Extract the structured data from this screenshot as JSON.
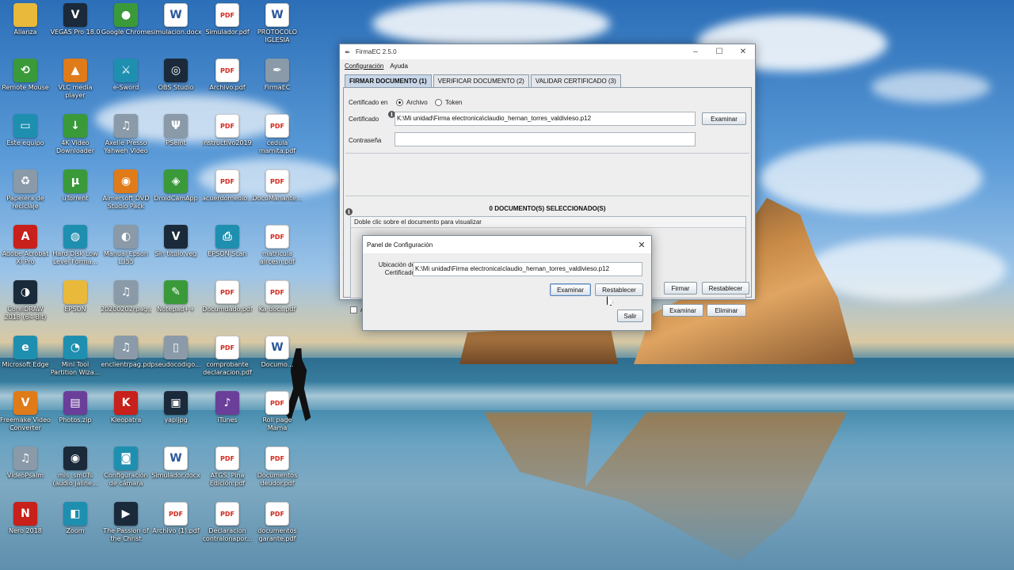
{
  "desktop": {
    "icons": [
      {
        "label": "Alianza",
        "icon": "folder-icon"
      },
      {
        "label": "VEGAS Pro 18.0",
        "icon": "vegas-icon"
      },
      {
        "label": "Google Chrome",
        "icon": "chrome-icon"
      },
      {
        "label": "simulacion.docx",
        "icon": "word-icon"
      },
      {
        "label": "Simulador.pdf",
        "icon": "pdf-icon"
      },
      {
        "label": "PROTOCOLO IGLESIA ALIAN...",
        "icon": "word-icon"
      },
      {
        "label": "Remote Mouse",
        "icon": "remote-mouse-icon"
      },
      {
        "label": "VLC media player",
        "icon": "vlc-icon"
      },
      {
        "label": "e-Sword",
        "icon": "esword-icon"
      },
      {
        "label": "OBS Studio",
        "icon": "obs-icon"
      },
      {
        "label": "Archivo.pdf",
        "icon": "pdf-icon"
      },
      {
        "label": "FirmaEC",
        "icon": "firmaec-icon"
      },
      {
        "label": "Este equipo",
        "icon": "computer-icon"
      },
      {
        "label": "4K Video Downloader",
        "icon": "downloader-icon"
      },
      {
        "label": "Axelle Presso Yahweh Video ...",
        "icon": "media-icon"
      },
      {
        "label": "PSeint",
        "icon": "pseint-icon"
      },
      {
        "label": "instructivo2019...",
        "icon": "pdf-icon"
      },
      {
        "label": "cedula mamita.pdf",
        "icon": "pdf-icon"
      },
      {
        "label": "Papelera de reciclaje",
        "icon": "recycle-bin-icon"
      },
      {
        "label": "uTorrent",
        "icon": "utorrent-icon"
      },
      {
        "label": "Aimersoft DVD Studio Pack",
        "icon": "dvd-icon"
      },
      {
        "label": "DroidCamApp",
        "icon": "droidcam-icon"
      },
      {
        "label": "acuerdomedio...",
        "icon": "pdf-icon"
      },
      {
        "label": "DocuManante...",
        "icon": "pdf-icon"
      },
      {
        "label": "Adobe Acrobat XI Pro",
        "icon": "acrobat-icon"
      },
      {
        "label": "Hard Disk Low Level Forma...",
        "icon": "disk-icon"
      },
      {
        "label": "Manual Epson L355",
        "icon": "manual-icon"
      },
      {
        "label": "Sin título.veg",
        "icon": "vegas-icon"
      },
      {
        "label": "EPSON Scan",
        "icon": "scanner-icon"
      },
      {
        "label": "matricula alrcesn.pdf",
        "icon": "pdf-icon"
      },
      {
        "label": "CorelDRAW 2018 (64-Bit)",
        "icon": "corel-icon"
      },
      {
        "label": "EPSON",
        "icon": "folder-icon"
      },
      {
        "label": "20200202rpag.pd",
        "icon": "media-icon"
      },
      {
        "label": "Notepad++",
        "icon": "notepad-icon"
      },
      {
        "label": "Documdado.pdf",
        "icon": "pdf-icon"
      },
      {
        "label": "Ka docs.pdf",
        "icon": "pdf-icon"
      },
      {
        "label": "Microsoft Edge",
        "icon": "edge-icon"
      },
      {
        "label": "Mini Tool Partition Wiza...",
        "icon": "partition-icon"
      },
      {
        "label": "enclientrpag.pd",
        "icon": "media-icon"
      },
      {
        "label": "pseudocodigo...",
        "icon": "file-icon"
      },
      {
        "label": "comprobante declaracion.pdf",
        "icon": "pdf-icon"
      },
      {
        "label": "Documo...",
        "icon": "word-icon"
      },
      {
        "label": "Freemake Video Converter",
        "icon": "freemake-icon"
      },
      {
        "label": "Photos.zip",
        "icon": "zip-icon"
      },
      {
        "label": "Kleopatra",
        "icon": "kleopatra-icon"
      },
      {
        "label": "yapijpg",
        "icon": "image-icon"
      },
      {
        "label": "iTunes",
        "icon": "itunes-icon"
      },
      {
        "label": "Roll page Mama Odd.oepdf",
        "icon": "pdf-icon"
      },
      {
        "label": "VideoPsalm",
        "icon": "media-icon"
      },
      {
        "label": "mis .sm0Ts (audio jaline...",
        "icon": "audio-icon"
      },
      {
        "label": "Configuración de cámara Logitech",
        "icon": "camera-icon"
      },
      {
        "label": "Simulador.docx",
        "icon": "word-icon"
      },
      {
        "label": "ATGS. Pina Edición.pdf",
        "icon": "pdf-icon"
      },
      {
        "label": "Documentos deudor.pdf",
        "icon": "pdf-icon"
      },
      {
        "label": "Nero 2018",
        "icon": "nero-icon"
      },
      {
        "label": "Zoom",
        "icon": "zoom-icon"
      },
      {
        "label": "The Passion of the Christ (200...",
        "icon": "video-icon"
      },
      {
        "label": "Archivo (1).pdf",
        "icon": "pdf-icon"
      },
      {
        "label": "Declaracion contralonapor...",
        "icon": "pdf-icon"
      },
      {
        "label": "documentos garante.pdf",
        "icon": "pdf-icon"
      }
    ]
  },
  "main_window": {
    "title": "FirmaEC 2.5.0",
    "menu": [
      "Configuración",
      "Ayuda"
    ],
    "tabs": [
      "FIRMAR DOCUMENTO (1)",
      "VERIFICAR DOCUMENTO (2)",
      "VALIDAR CERTIFICADO (3)"
    ],
    "cert_in_label": "Certificado en",
    "radio_archivo": "Archivo",
    "radio_token": "Token",
    "certificado_label": "Certificado",
    "certificado_value": "K:\\Mi unidad\\Firma electronica\\claudio_hernan_torres_valdivieso.p12",
    "examinar_label": "Examinar",
    "password_label": "Contraseña",
    "password_value": "",
    "docs_header": "0 DOCUMENTO(S) SELECCIONADO(S)",
    "docs_hint": "Doble clic sobre el documento para visualizar",
    "checkbox_label": "A",
    "docs_examinar": "Examinar",
    "eliminar": "Eliminar",
    "firmar": "Firmar",
    "restablecer": "Restablecer"
  },
  "config_dialog": {
    "title": "Panel de Configuración",
    "ubicacion_label_1": "Ubicación de",
    "ubicacion_label_2": "Certificado",
    "ubicacion_value": "K:\\Mi unidad\\Firma electronica\\claudio_hernan_torres_valdivieso.p12",
    "examinar": "Examinar",
    "restablecer": "Restablecer",
    "salir": "Salir"
  }
}
